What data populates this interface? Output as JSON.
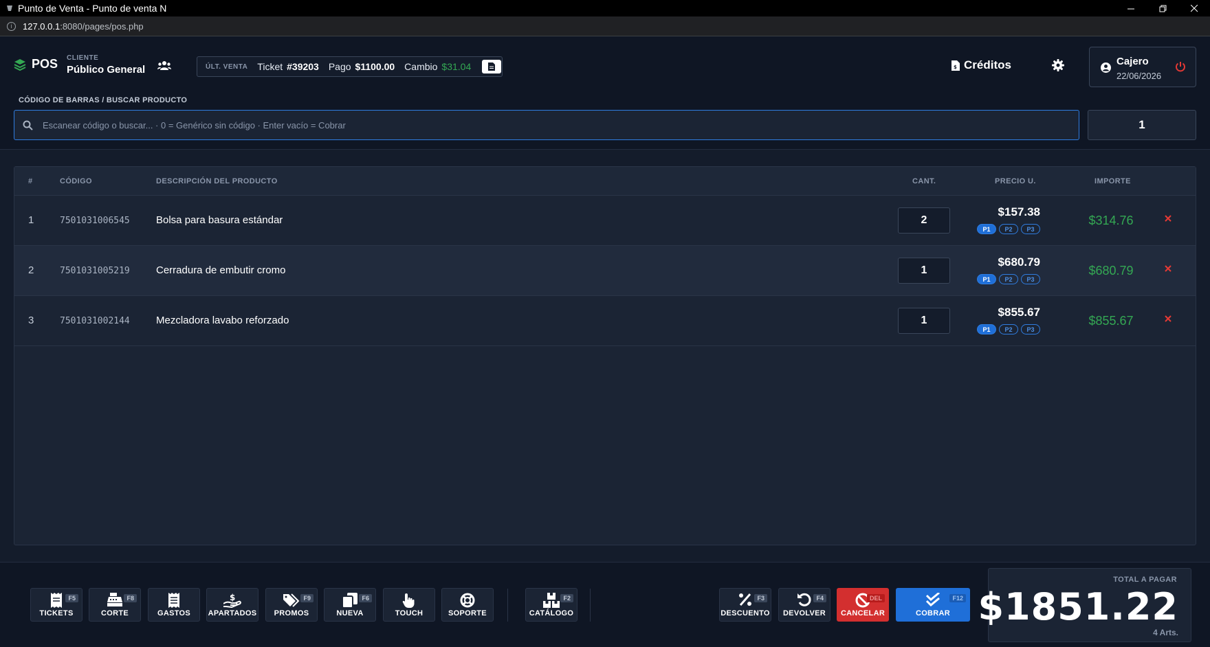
{
  "window": {
    "title": "Punto de Venta - Punto de venta N",
    "url_host": "127.0.0.1",
    "url_rest": ":8080/pages/pos.php"
  },
  "header": {
    "logo": "POS",
    "client_label": "CLIENTE",
    "client_name": "Público General",
    "last_sale": {
      "label": "ÚLT. VENTA",
      "ticket_prefix": "Ticket",
      "ticket_number": "#39203",
      "payment_prefix": "Pago",
      "payment": "$1100.00",
      "change_prefix": "Cambio",
      "change": "$31.04"
    },
    "credits_label": "Créditos",
    "cashier_name": "Cajero",
    "cashier_date": "22/06/2026"
  },
  "search": {
    "label": "CÓDIGO DE BARRAS / BUSCAR PRODUCTO",
    "placeholder": "Escanear código o buscar... · 0 = Genérico sin código · Enter vacío = Cobrar",
    "quantity": "1"
  },
  "table": {
    "headers": {
      "index": "#",
      "code": "CÓDIGO",
      "description": "DESCRIPCIÓN DEL PRODUCTO",
      "qty": "CANT.",
      "unit_price": "PRECIO U.",
      "amount": "IMPORTE"
    },
    "tiers": [
      "P1",
      "P2",
      "P3"
    ],
    "rows": [
      {
        "index": "1",
        "code": "7501031006545",
        "description": "Bolsa para basura estándar",
        "qty": "2",
        "price": "$157.38",
        "amount": "$314.76"
      },
      {
        "index": "2",
        "code": "7501031005219",
        "description": "Cerradura de embutir cromo",
        "qty": "1",
        "price": "$680.79",
        "amount": "$680.79"
      },
      {
        "index": "3",
        "code": "7501031002144",
        "description": "Mezcladora lavabo reforzado",
        "qty": "1",
        "price": "$855.67",
        "amount": "$855.67"
      }
    ]
  },
  "footer": {
    "buttons": {
      "tickets": {
        "label": "TICKETS",
        "key": "F5"
      },
      "corte": {
        "label": "CORTE",
        "key": "F8"
      },
      "gastos": {
        "label": "GASTOS",
        "key": ""
      },
      "apartados": {
        "label": "APARTADOS",
        "key": ""
      },
      "promos": {
        "label": "PROMOS",
        "key": "F9"
      },
      "nueva": {
        "label": "NUEVA",
        "key": "F6"
      },
      "touch": {
        "label": "TOUCH",
        "key": ""
      },
      "soporte": {
        "label": "SOPORTE",
        "key": ""
      },
      "catalogo": {
        "label": "CATÁLOGO",
        "key": "F2"
      },
      "descuento": {
        "label": "DESCUENTO",
        "key": "F3"
      },
      "devolver": {
        "label": "DEVOLVER",
        "key": "F4"
      },
      "cancelar": {
        "label": "CANCELAR",
        "key": "DEL"
      },
      "cobrar": {
        "label": "COBRAR",
        "key": "F12"
      }
    },
    "total_label": "TOTAL A PAGAR",
    "total": "$1851.22",
    "articles": "4 Arts."
  },
  "colors": {
    "accent": "#1f6fd8",
    "success": "#34a853",
    "danger": "#d32f2f",
    "background": "#141c2b"
  }
}
